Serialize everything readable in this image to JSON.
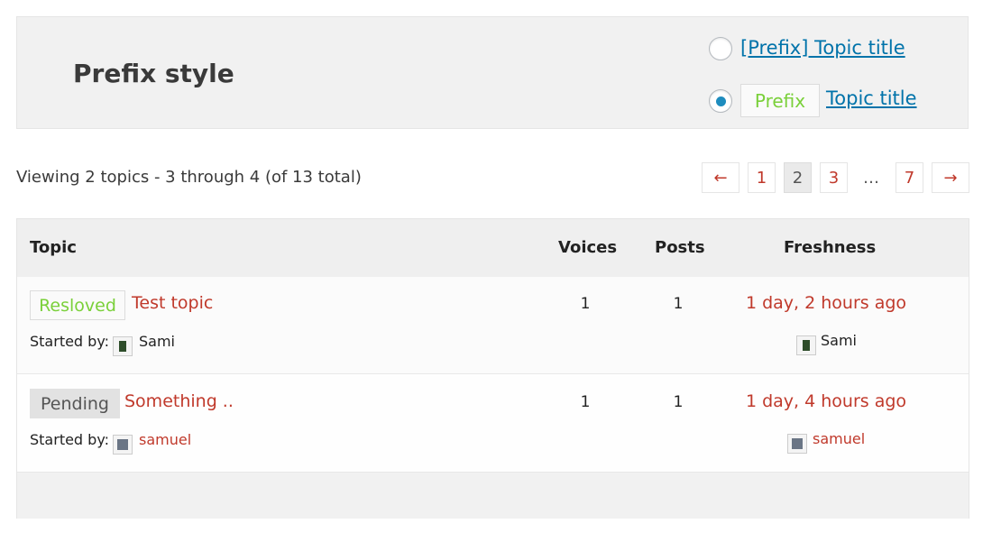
{
  "prefix_style": {
    "heading": "Prefix style",
    "option1_link": "[Prefix] Topic title",
    "option2_prefix": "Prefix",
    "option2_link": "Topic title",
    "selected": "option2",
    "radio_color": "#1e8cbe",
    "prefix_color": "#7ad03a"
  },
  "viewing": "Viewing 2 topics - 3 through 4 (of 13 total)",
  "pagination": {
    "prev": "←",
    "pages": [
      "1",
      "2",
      "3"
    ],
    "dots": "…",
    "last": "7",
    "next": "→",
    "current": "2"
  },
  "table": {
    "headers": {
      "topic": "Topic",
      "voices": "Voices",
      "posts": "Posts",
      "freshness": "Freshness"
    },
    "started_by_label": "Started by:",
    "rows": [
      {
        "status": "Resloved",
        "title": "Test topic",
        "author": "Sami",
        "voices": "1",
        "posts": "1",
        "freshness": "1 day, 2 hours ago",
        "last_author": "Sami"
      },
      {
        "status": "Pending",
        "title": "Something ..",
        "author": "samuel",
        "voices": "1",
        "posts": "1",
        "freshness": "1 day, 4 hours ago",
        "last_author": "samuel"
      }
    ]
  },
  "colors": {
    "link_red": "#c0392b",
    "link_blue": "#0073aa",
    "resolved_green": "#7ad03a",
    "header_bg": "#efefef"
  }
}
